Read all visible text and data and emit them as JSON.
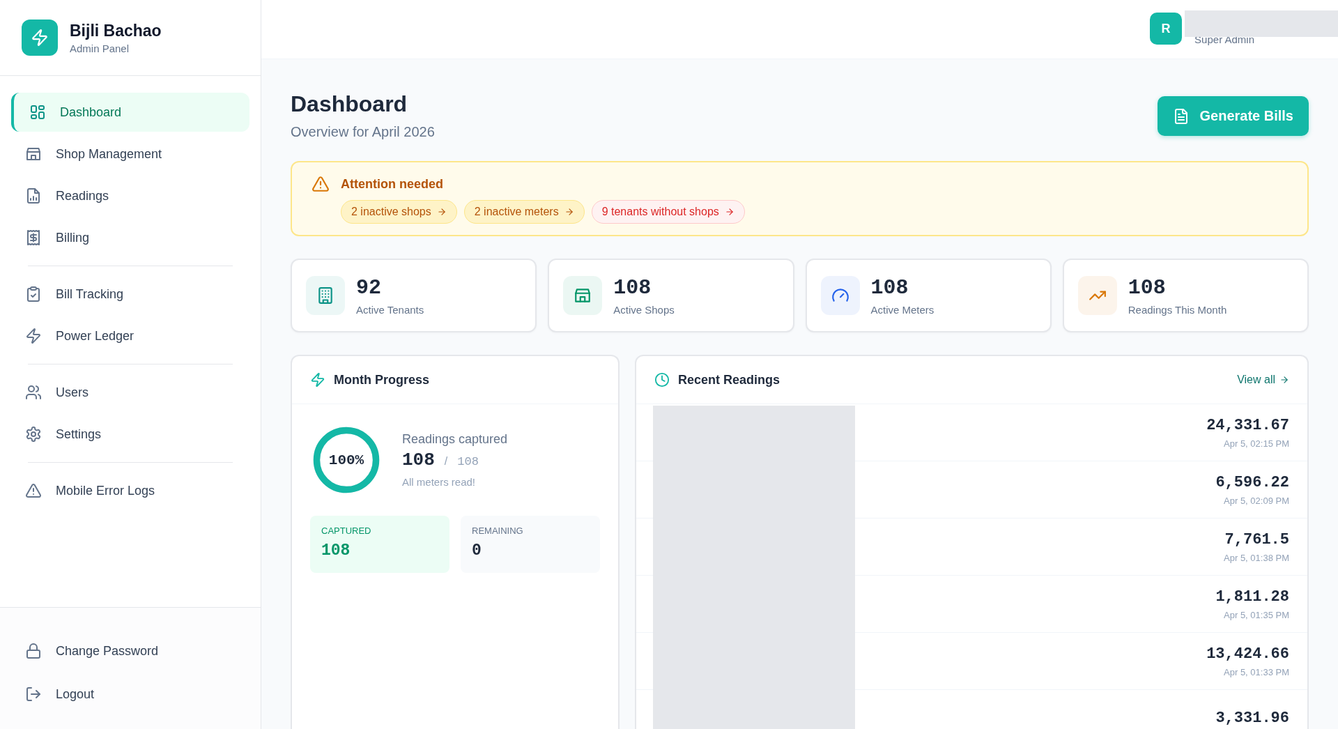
{
  "brand": {
    "name": "Bijli Bachao",
    "subtitle": "Admin Panel"
  },
  "sidebar": {
    "groups": [
      {
        "items": [
          {
            "label": "Dashboard",
            "selected": true
          },
          {
            "label": "Shop Management",
            "selected": false
          },
          {
            "label": "Readings",
            "selected": false
          },
          {
            "label": "Billing",
            "selected": false
          }
        ]
      },
      {
        "items": [
          {
            "label": "Bill Tracking",
            "selected": false
          },
          {
            "label": "Power Ledger",
            "selected": false
          }
        ]
      },
      {
        "items": [
          {
            "label": "Users",
            "selected": false
          },
          {
            "label": "Settings",
            "selected": false
          }
        ]
      },
      {
        "items": [
          {
            "label": "Mobile Error Logs",
            "selected": false
          }
        ]
      }
    ],
    "footer_items": [
      {
        "label": "Change Password"
      },
      {
        "label": "Logout"
      }
    ]
  },
  "user": {
    "initial": "R",
    "role": "Super Admin"
  },
  "page": {
    "title": "Dashboard",
    "subtitle": "Overview for April 2026",
    "action": "Generate Bills"
  },
  "alert": {
    "title": "Attention needed",
    "chips": [
      {
        "label": "2 inactive shops",
        "kind": "warning"
      },
      {
        "label": "2 inactive meters",
        "kind": "warning"
      },
      {
        "label": "9 tenants without shops",
        "kind": "danger"
      }
    ]
  },
  "stats": [
    {
      "value": "92",
      "label": "Active Tenants",
      "color": "#0d9488"
    },
    {
      "value": "108",
      "label": "Active Shops",
      "color": "#059669"
    },
    {
      "value": "108",
      "label": "Active Meters",
      "color": "#2563eb"
    },
    {
      "value": "108",
      "label": "Readings This Month",
      "color": "#d97706"
    }
  ],
  "month_progress": {
    "title": "Month Progress",
    "percent": "100%",
    "level": 1,
    "caption": "Readings captured",
    "captured_count": "108",
    "separator": "/",
    "total": "108",
    "note": "All meters read!",
    "tiles": [
      {
        "label": "CAPTURED",
        "value": "108",
        "kind": "captured"
      },
      {
        "label": "REMAINING",
        "value": "0",
        "kind": "remaining"
      }
    ]
  },
  "recent_readings": {
    "title": "Recent Readings",
    "link": "View all",
    "rows": [
      {
        "value": "24,331.67",
        "time": "Apr 5, 02:15 PM"
      },
      {
        "value": "6,596.22",
        "time": "Apr 5, 02:09 PM"
      },
      {
        "value": "7,761.5",
        "time": "Apr 5, 01:38 PM"
      },
      {
        "value": "1,811.28",
        "time": "Apr 5, 01:35 PM"
      },
      {
        "value": "13,424.66",
        "time": "Apr 5, 01:33 PM"
      },
      {
        "value": "3,331.96"
      }
    ]
  }
}
